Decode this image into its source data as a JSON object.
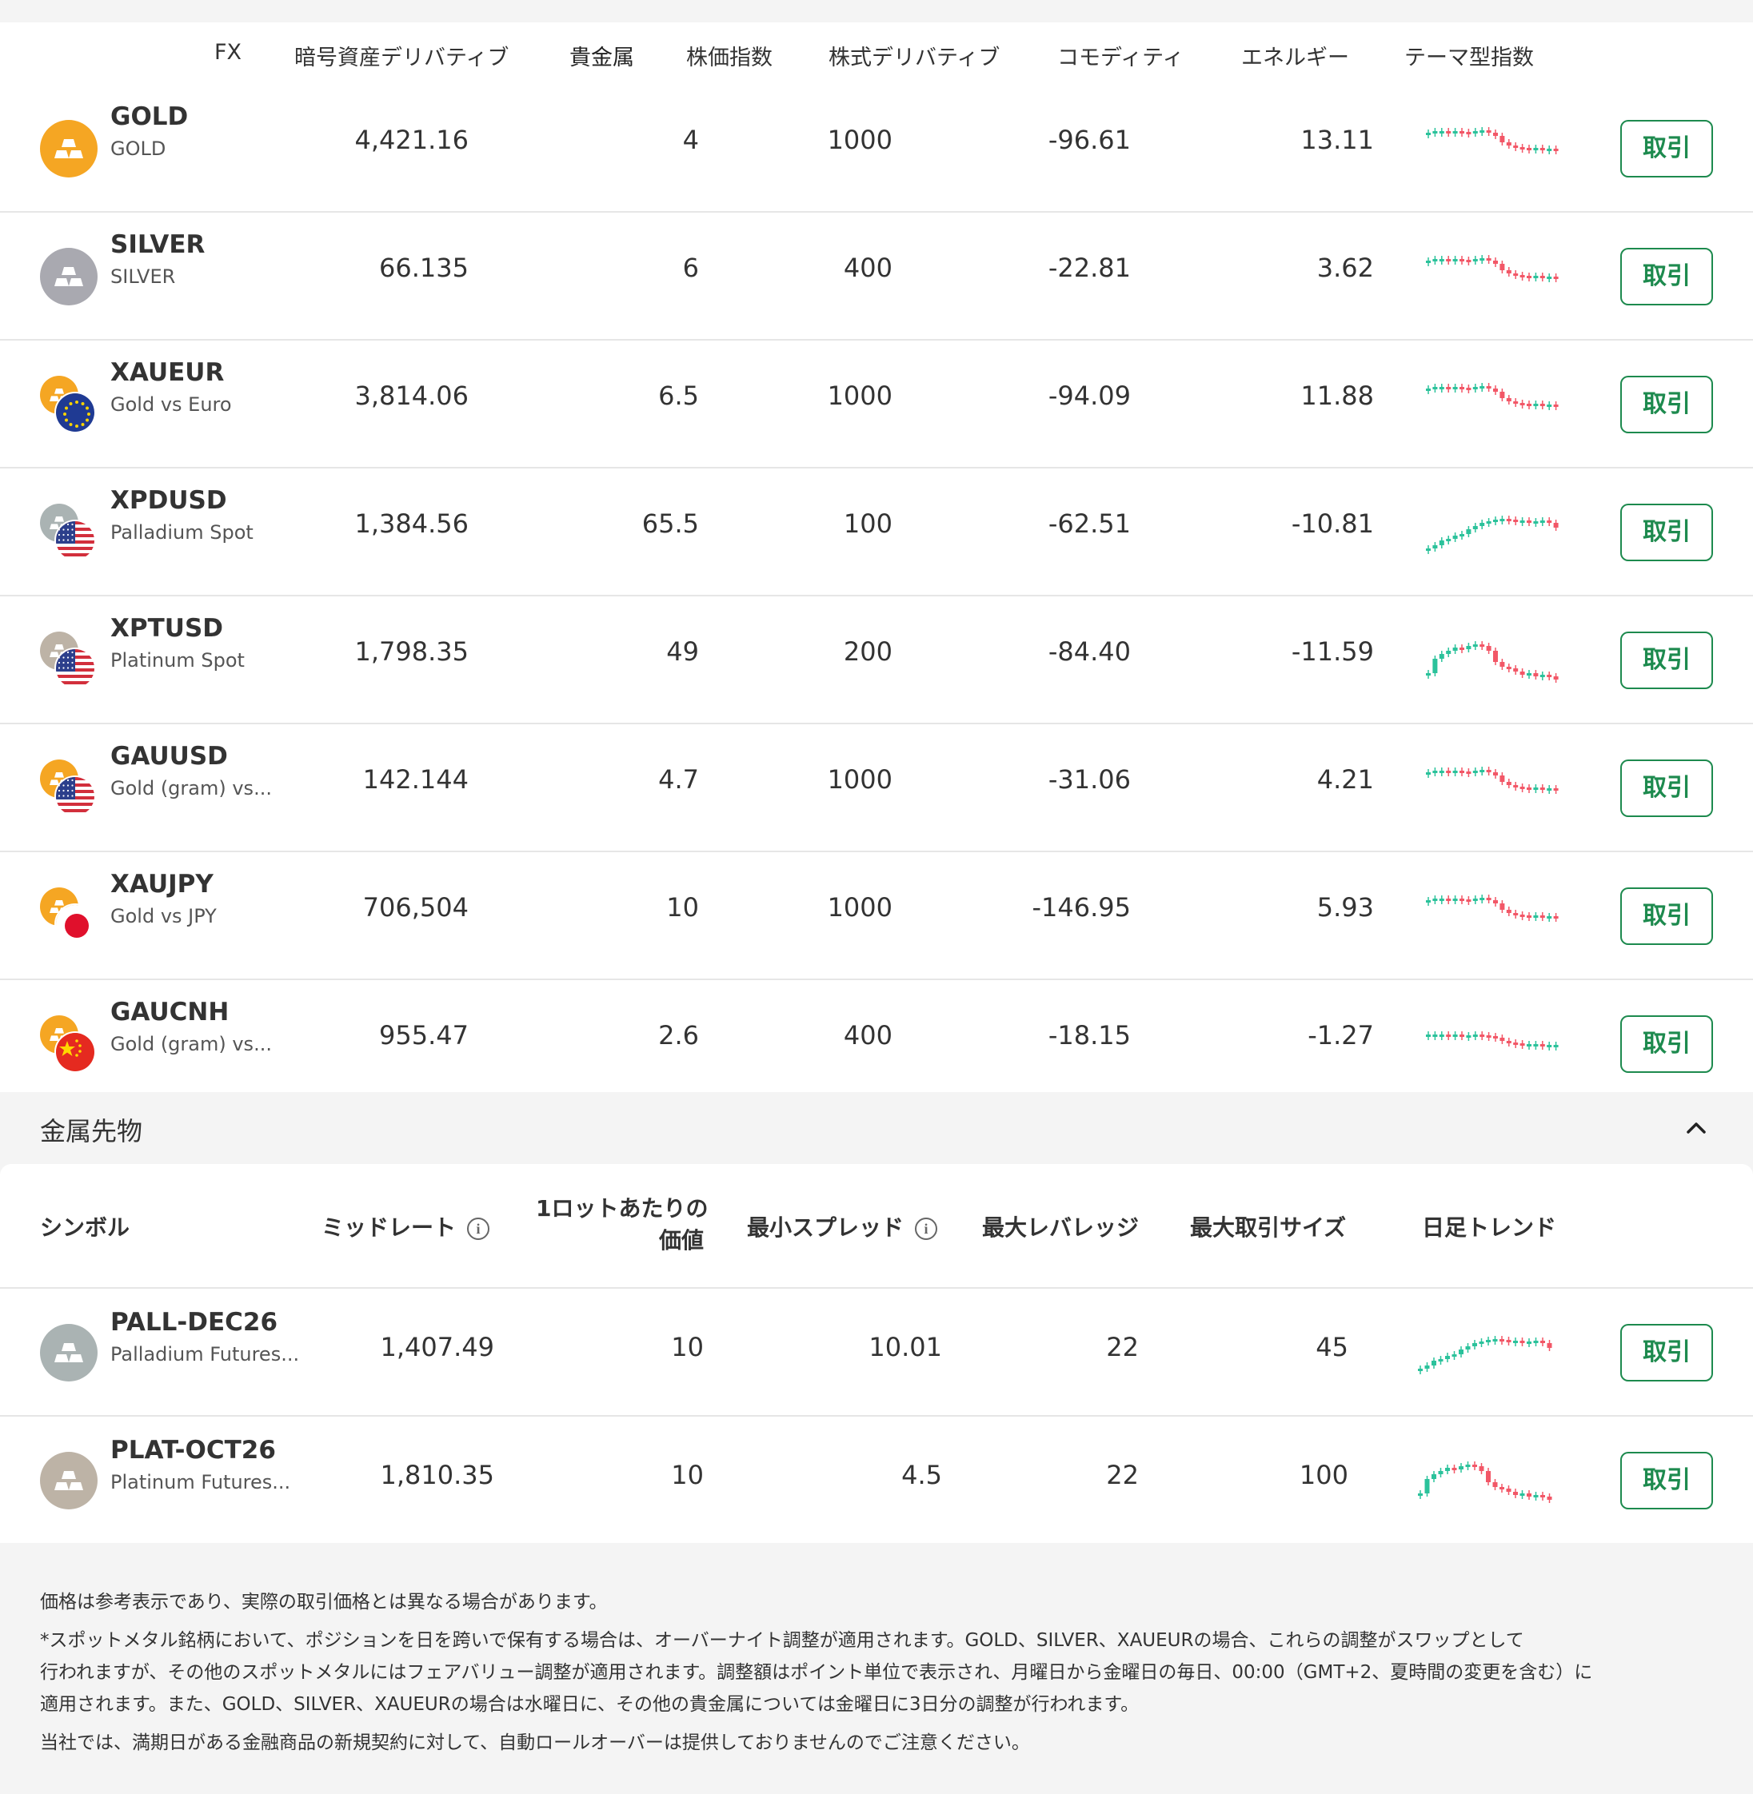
{
  "tabs": [
    "FX",
    "暗号資産デリバティブ",
    "貴金属",
    "株価指数",
    "株式デリバティブ",
    "コモディティ",
    "エネルギー",
    "テーマ型指数"
  ],
  "active_tab": "貴金属",
  "spot_rows": [
    {
      "symbol": "GOLD",
      "name": "GOLD",
      "mid": "4,421.16",
      "spread": "4",
      "lot": "1000",
      "swap_long": "-96.61",
      "swap_short": "13.11",
      "metal_color": "#f5a623",
      "flag": "none",
      "trend": "down",
      "trade": "取引"
    },
    {
      "symbol": "SILVER",
      "name": "SILVER",
      "mid": "66.135",
      "spread": "6",
      "lot": "400",
      "swap_long": "-22.81",
      "swap_short": "3.62",
      "metal_color": "#a9a9b0",
      "flag": "none",
      "trend": "down",
      "trade": "取引"
    },
    {
      "symbol": "XAUEUR",
      "name": "Gold vs Euro",
      "mid": "3,814.06",
      "spread": "6.5",
      "lot": "1000",
      "swap_long": "-94.09",
      "swap_short": "11.88",
      "metal_color": "#f5a623",
      "flag": "eu",
      "trend": "down",
      "trade": "取引"
    },
    {
      "symbol": "XPDUSD",
      "name": "Palladium Spot",
      "mid": "1,384.56",
      "spread": "65.5",
      "lot": "100",
      "swap_long": "-62.51",
      "swap_short": "-10.81",
      "metal_color": "#aab3b3",
      "flag": "us",
      "trend": "up",
      "trade": "取引"
    },
    {
      "symbol": "XPTUSD",
      "name": "Platinum Spot",
      "mid": "1,798.35",
      "spread": "49",
      "lot": "200",
      "swap_long": "-84.40",
      "swap_short": "-11.59",
      "metal_color": "#bdb3a6",
      "flag": "us",
      "trend": "spike",
      "trade": "取引"
    },
    {
      "symbol": "GAUUSD",
      "name": "Gold (gram) vs...",
      "mid": "142.144",
      "spread": "4.7",
      "lot": "1000",
      "swap_long": "-31.06",
      "swap_short": "4.21",
      "metal_color": "#f5a623",
      "flag": "us",
      "trend": "down",
      "trade": "取引"
    },
    {
      "symbol": "XAUJPY",
      "name": "Gold vs JPY",
      "mid": "706,504",
      "spread": "10",
      "lot": "1000",
      "swap_long": "-146.95",
      "swap_short": "5.93",
      "metal_color": "#f5a623",
      "flag": "jp",
      "trend": "down",
      "trade": "取引"
    },
    {
      "symbol": "GAUCNH",
      "name": "Gold (gram) vs...",
      "mid": "955.47",
      "spread": "2.6",
      "lot": "400",
      "swap_long": "-18.15",
      "swap_short": "-1.27",
      "metal_color": "#f5a623",
      "flag": "cn",
      "trend": "flatdown",
      "trade": "取引"
    }
  ],
  "futures_section": {
    "title": "金属先物",
    "headers": {
      "symbol": "シンボル",
      "mid": "ミッドレート",
      "lot_value_1": "1ロットあたりの",
      "lot_value_2": "価値",
      "min_spread": "最小スプレッド",
      "max_leverage": "最大レバレッジ",
      "max_size": "最大取引サイズ",
      "trend": "日足トレンド"
    },
    "info_glyph": "i",
    "rows": [
      {
        "symbol": "PALL-DEC26",
        "name": "Palladium Futures...",
        "mid": "1,407.49",
        "lot_value": "10",
        "min_spread": "10.01",
        "max_leverage": "22",
        "max_size": "45",
        "metal_color": "#aab3b3",
        "trend": "up",
        "trade": "取引"
      },
      {
        "symbol": "PLAT-OCT26",
        "name": "Platinum Futures...",
        "mid": "1,810.35",
        "lot_value": "10",
        "min_spread": "4.5",
        "max_leverage": "22",
        "max_size": "100",
        "metal_color": "#bdb3a6",
        "trend": "spike",
        "trade": "取引"
      }
    ]
  },
  "footer": {
    "line1": "価格は参考表示であり、実際の取引価格とは異なる場合があります。",
    "line2": "*スポットメタル銘柄において、ポジションを日を跨いで保有する場合は、オーバーナイト調整が適用されます。GOLD、SILVER、XAUEURの場合、これらの調整がスワップとして",
    "line3": "行われますが、その他のスポットメタルにはフェアバリュー調整が適用されます。調整額はポイント単位で表示され、月曜日から金曜日の毎日、00:00（GMT+2、夏時間の変更を含む）に",
    "line4": "適用されます。また、GOLD、SILVER、XAUEURの場合は水曜日に、その他の貴金属については金曜日に3日分の調整が行われます。",
    "line5": "当社では、満期日がある金融商品の新規契約に対して、自動ロールオーバーは提供しておりませんのでご注意ください。"
  },
  "colors": {
    "accent": "#1d8a4e",
    "candle_up": "#2bc29b",
    "candle_down": "#f25767"
  }
}
